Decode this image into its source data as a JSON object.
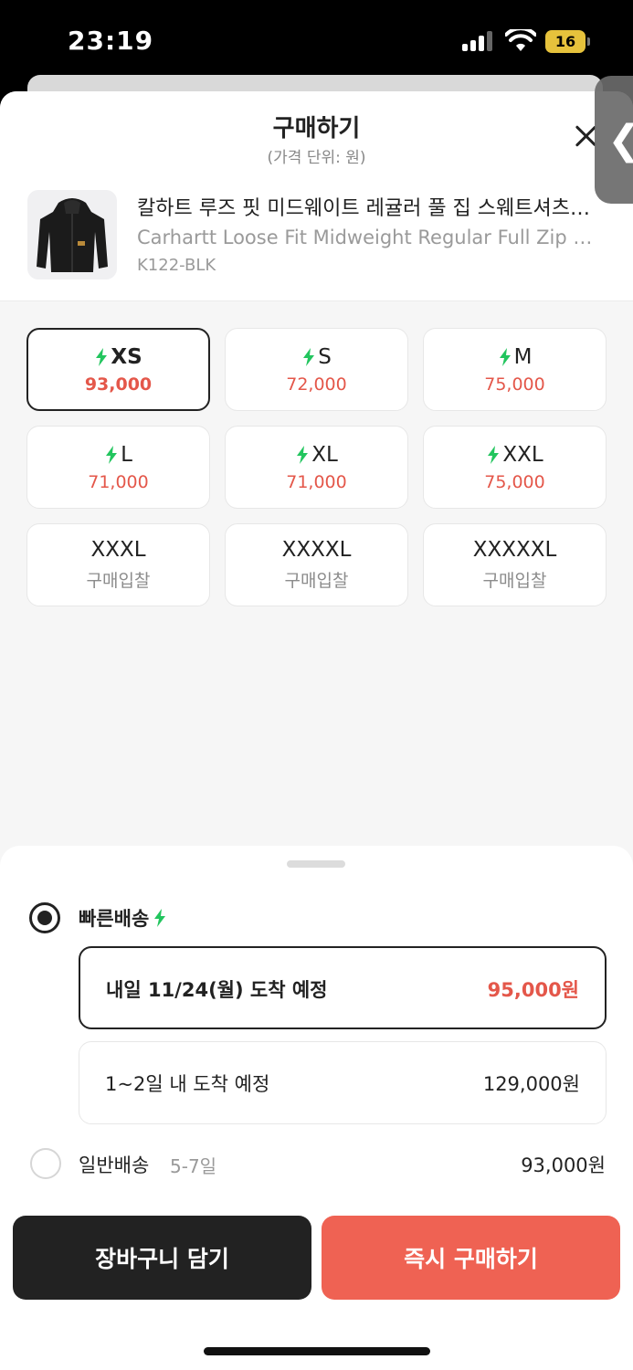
{
  "status_bar": {
    "time": "23:19",
    "battery": "16"
  },
  "header": {
    "title": "구매하기",
    "subtitle": "(가격 단위: 원)"
  },
  "product": {
    "name_ko": "칼하트 루즈 핏 미드웨이트 레귤러 풀 집 스웨트셔츠 블랙",
    "name_en": "Carhartt Loose Fit Midweight Regular Full Zip Sweatshirt Black",
    "code": "K122-BLK"
  },
  "sizes": [
    {
      "label": "XS",
      "price": "93,000",
      "fast": true,
      "selected": true
    },
    {
      "label": "S",
      "price": "72,000",
      "fast": true
    },
    {
      "label": "M",
      "price": "75,000",
      "fast": true
    },
    {
      "label": "L",
      "price": "71,000",
      "fast": true
    },
    {
      "label": "XL",
      "price": "71,000",
      "fast": true
    },
    {
      "label": "XXL",
      "price": "75,000",
      "fast": true
    },
    {
      "label": "XXXL",
      "price": "구매입찰",
      "fast": false
    },
    {
      "label": "XXXXL",
      "price": "구매입찰",
      "fast": false
    },
    {
      "label": "XXXXXL",
      "price": "구매입찰",
      "fast": false
    }
  ],
  "delivery": {
    "fast_title": "빠른배송",
    "fast_options": [
      {
        "label": "내일 11/24(월) 도착 예정",
        "price": "95,000원",
        "selected": true
      },
      {
        "label": "1~2일 내 도착 예정",
        "price": "129,000원"
      }
    ],
    "standard_title": "일반배송",
    "standard_days": "5-7일",
    "standard_price": "93,000원"
  },
  "actions": {
    "cart": "장바구니 담기",
    "buy": "즉시 구매하기"
  },
  "colors": {
    "accent": "#ef6253",
    "price_red": "#e4574a",
    "bolt_green": "#22c55e",
    "dark": "#222222"
  }
}
